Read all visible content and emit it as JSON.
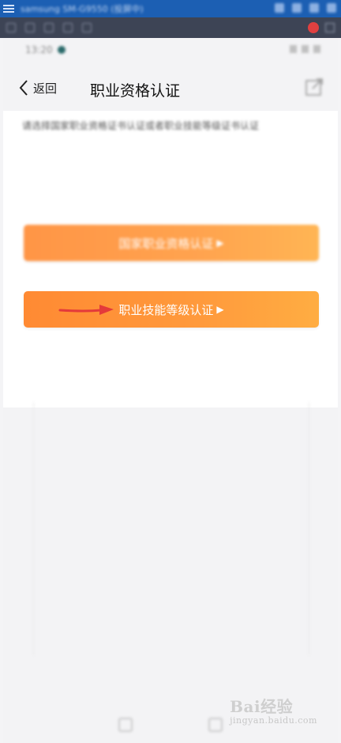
{
  "mirror_bar": {
    "title": "samsung SM-G9550 (投屏中)"
  },
  "statusbar": {
    "time": "13:20"
  },
  "navbar": {
    "back_label": "返回",
    "title": "职业资格认证"
  },
  "content": {
    "instruction": "请选择国家职业资格证书认证或者职业技能等级证书认证",
    "buttons": [
      {
        "label": "国家职业资格认证",
        "suffix": "▶"
      },
      {
        "label": "职业技能等级认证",
        "suffix": "▶"
      }
    ]
  },
  "watermark": {
    "brand": "Bai经验",
    "sub": "jingyan.baidu.com"
  },
  "colors": {
    "accent": "#ff9a3c",
    "arrow": "#e43a3a",
    "mirror_bar": "#1c5fb3"
  }
}
